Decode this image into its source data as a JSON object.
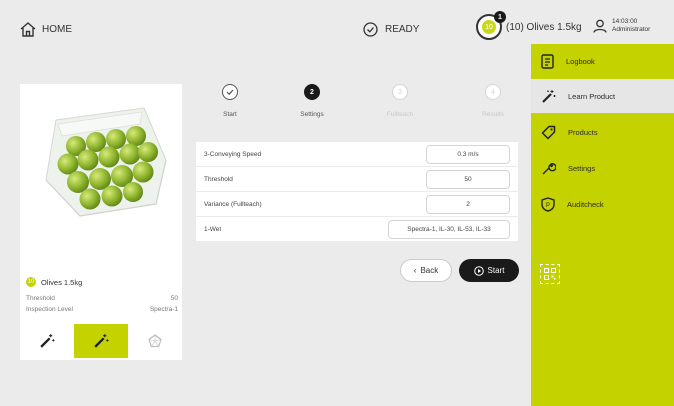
{
  "header": {
    "home_label": "HOME",
    "status_label": "READY",
    "product_indicator": {
      "badge": "1",
      "number": "10",
      "label": "(10) Olives 1.5kg"
    },
    "user": {
      "time": "14:03:00",
      "role": "Administrator"
    }
  },
  "sidebar": {
    "items": [
      {
        "label": "Logbook",
        "icon": "logbook-icon"
      },
      {
        "label": "Learn Product",
        "icon": "wand-icon"
      },
      {
        "label": "Products",
        "icon": "tag-icon"
      },
      {
        "label": "Settings",
        "icon": "wrench-icon"
      },
      {
        "label": "Auditcheck",
        "icon": "shield-icon"
      }
    ],
    "active_index": 1,
    "accent": "#c4d200"
  },
  "product_card": {
    "number": "10",
    "name": "Olives 1.5kg",
    "rows": [
      {
        "label": "Threshold",
        "value": "50"
      },
      {
        "label": "Inspection Level",
        "value": "Spectra-1"
      }
    ]
  },
  "steps": [
    {
      "label": "Start",
      "marker": "",
      "state": "done"
    },
    {
      "label": "Settings",
      "marker": "2",
      "state": "current"
    },
    {
      "label": "Fullteach",
      "marker": "3",
      "state": "todo"
    },
    {
      "label": "Results",
      "marker": "4",
      "state": "todo"
    }
  ],
  "settings_form": [
    {
      "label": "3-Conveying Speed",
      "value": "0.3 m/s"
    },
    {
      "label": "Threshold",
      "value": "50"
    },
    {
      "label": "Variance (Fullteach)",
      "value": "2"
    },
    {
      "label": "1-Wet",
      "value": "Spectra-1, IL-30, IL-53, IL-33"
    }
  ],
  "buttons": {
    "back": "Back",
    "start": "Start"
  }
}
